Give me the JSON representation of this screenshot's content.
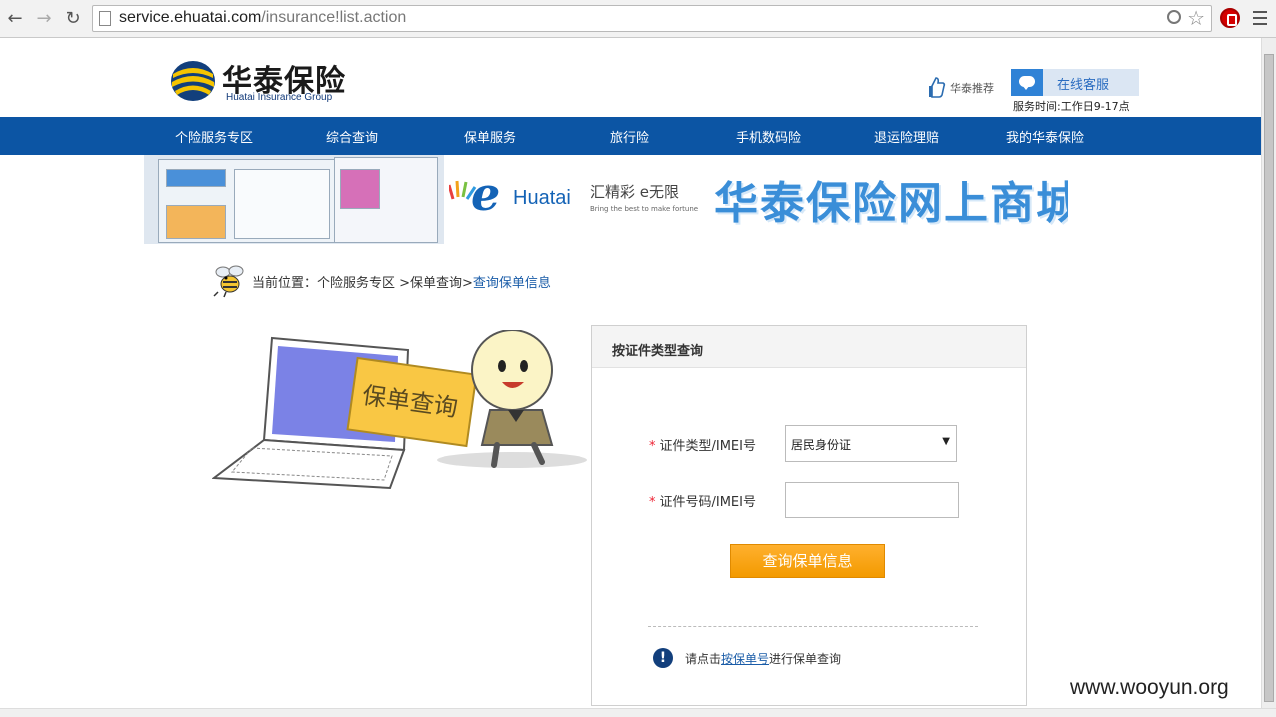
{
  "browser": {
    "url_host": "service.ehuatai.com",
    "url_path": "/insurance!list.action"
  },
  "header": {
    "logo_cn": "华泰保险",
    "logo_en": "Huatai Insurance Group",
    "recommend_label": "华泰推荐",
    "customer_service_label": "在线客服",
    "service_time": "服务时间:工作日9-17点"
  },
  "nav": {
    "items": [
      {
        "label": "个险服务专区"
      },
      {
        "label": "综合查询"
      },
      {
        "label": "保单服务"
      },
      {
        "label": "旅行险"
      },
      {
        "label": "手机数码险"
      },
      {
        "label": "退运险理赔"
      },
      {
        "label": "我的华泰保险"
      }
    ]
  },
  "banner": {
    "brand": "Huatai",
    "slogan_cn": "汇精彩 e无限",
    "slogan_en": "Bring the best to make fortune",
    "title": "华泰保险网上商城"
  },
  "breadcrumb": {
    "prefix": "当前位置：个险服务专区 >保单查询>",
    "current": "查询保单信息"
  },
  "illustration": {
    "sign_text": "保单查询"
  },
  "query_panel": {
    "title": "按证件类型查询",
    "type_label": "证件类型/IMEI号",
    "type_value": "居民身份证",
    "number_label": "证件号码/IMEI号",
    "number_value": "",
    "submit_label": "查询保单信息",
    "hint_prefix": "请点击",
    "hint_link": "按保单号",
    "hint_suffix": "进行保单查询"
  },
  "watermark": "www.wooyun.org",
  "colors": {
    "nav_bg": "#0c55a4",
    "button_orange": "#f7a21b",
    "link_blue": "#1a5ca8"
  }
}
